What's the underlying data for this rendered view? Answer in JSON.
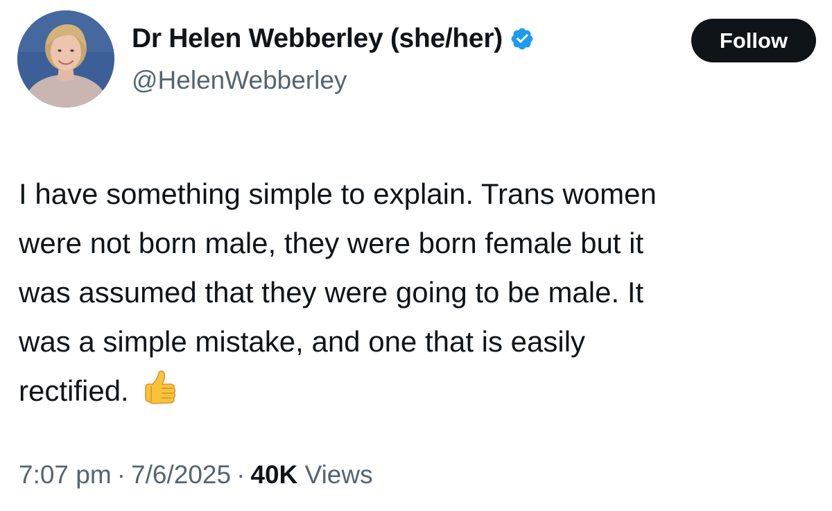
{
  "author": {
    "display_name": "Dr Helen Webberley (she/her)",
    "handle": "@HelenWebberley",
    "verified": true,
    "verified_color": "#1d9bf0",
    "avatar_icon": "profile-photo"
  },
  "follow_button": {
    "label": "Follow",
    "background": "#0f1419",
    "text_color": "#ffffff"
  },
  "tweet": {
    "lines": [
      "I have something simple to explain. Trans women",
      "were not born male, they were born female but it",
      "was assumed that they were going to be male. It",
      "was a simple mistake, and one that is easily",
      "rectified."
    ],
    "emoji": "thumbs-up-icon"
  },
  "meta": {
    "time": "7:07 pm",
    "separator": "·",
    "date": "7/6/2025",
    "views_count": "40K",
    "views_label": "Views"
  }
}
